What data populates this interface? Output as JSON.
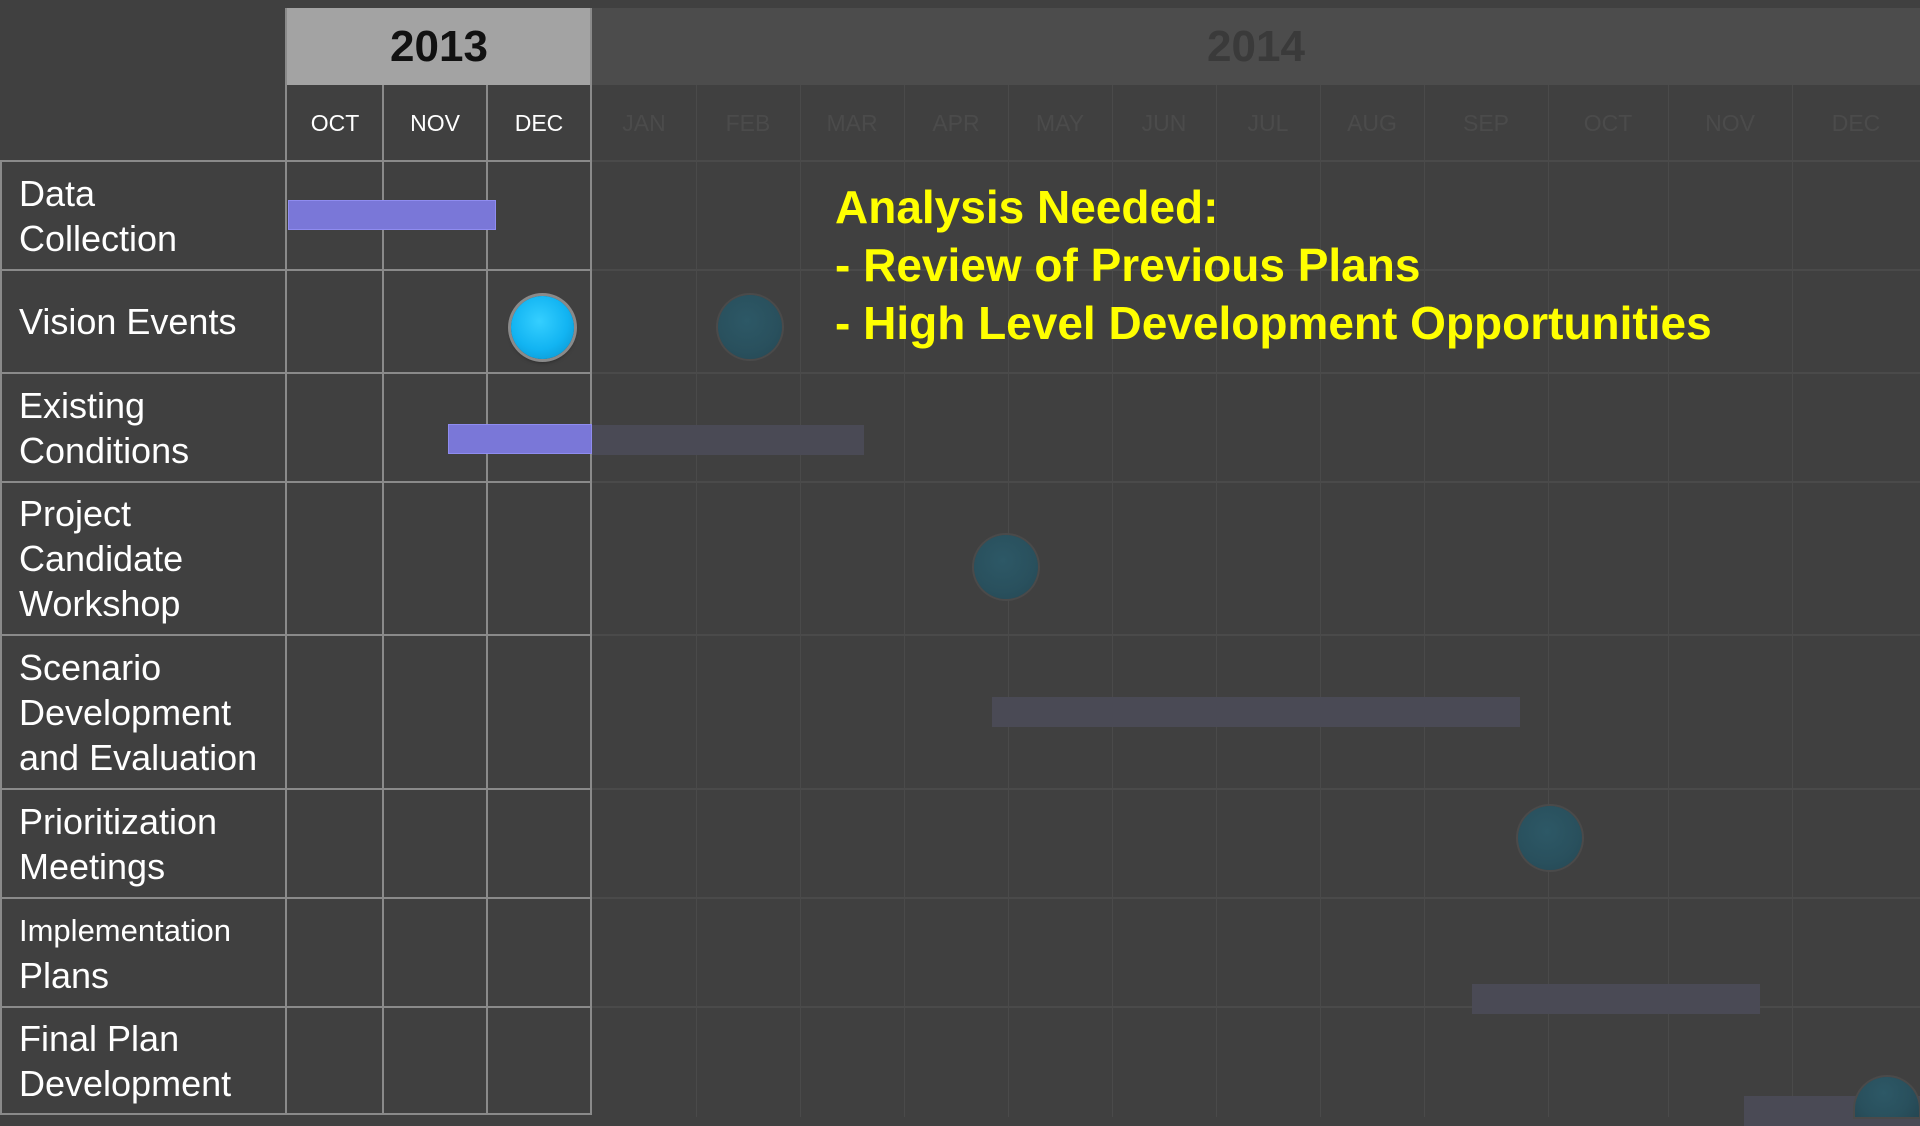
{
  "years": {
    "active": "2013",
    "faded": "2014"
  },
  "months_2013": [
    "OCT",
    "NOV",
    "DEC"
  ],
  "months_2014": [
    "JAN",
    "FEB",
    "MAR",
    "APR",
    "MAY",
    "JUN",
    "JUL",
    "AUG",
    "SEP",
    "OCT",
    "NOV",
    "DEC"
  ],
  "rows": [
    {
      "line1": "Data",
      "line2": "Collection"
    },
    {
      "line1": "Vision Events"
    },
    {
      "line1": "Existing",
      "line2": "Conditions"
    },
    {
      "line1": "Project",
      "line2": "Candidate",
      "line3": "Workshop"
    },
    {
      "line1": "Scenario",
      "line2": "Development",
      "line3": "and Evaluation"
    },
    {
      "line1": "Prioritization",
      "line2": "Meetings"
    },
    {
      "line1": "Implementation",
      "line2": "Plans"
    },
    {
      "line1": "Final Plan",
      "line2": "Development"
    }
  ],
  "note": {
    "line1": "Analysis Needed:",
    "line2": "- Review of Previous Plans",
    "line3": "- High Level Development Opportunities"
  },
  "colors": {
    "background": "#404040",
    "active_bar": "#7a77d8",
    "active_milestone": "#12b4f2",
    "note_text": "#ffff00"
  }
}
